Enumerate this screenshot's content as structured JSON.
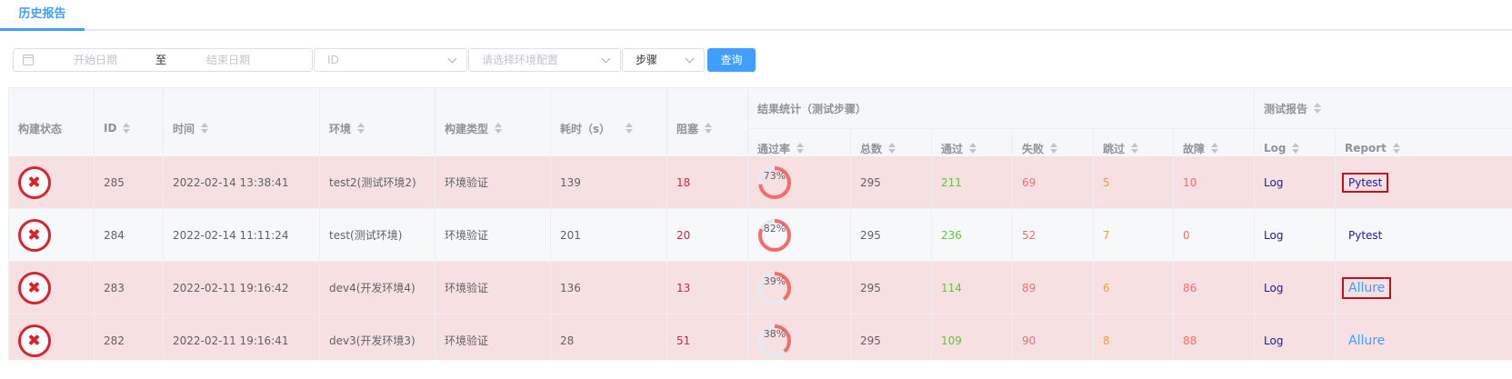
{
  "tab": {
    "label": "历史报告"
  },
  "filters": {
    "start_placeholder": "开始日期",
    "separator": "至",
    "end_placeholder": "结束日期",
    "id_placeholder": "ID",
    "env_placeholder": "请选择环境配置",
    "step_value": "步骤",
    "query_label": "查询"
  },
  "table": {
    "headers": {
      "status": "构建状态",
      "id": "ID",
      "time": "时间",
      "env": "环境",
      "build_type": "构建类型",
      "duration": "耗时（s）",
      "blocked": "阻塞",
      "result_group": "结果统计（测试步骤）",
      "pass_rate": "通过率",
      "total": "总数",
      "passed": "通过",
      "failed": "失败",
      "skipped": "跳过",
      "fault": "故障",
      "report_group": "测试报告",
      "log": "Log",
      "report": "Report"
    },
    "rows": [
      {
        "id": "285",
        "time": "2022-02-14 13:38:41",
        "env": "test2(测试环境2)",
        "build_type": "环境验证",
        "duration": "139",
        "blocked": "18",
        "pass_rate": 73,
        "pass_rate_label": "73%",
        "total": "295",
        "passed": "211",
        "failed": "69",
        "skipped": "5",
        "fault": "10",
        "log": "Log",
        "report": "Pytest",
        "report_kind": "pytest",
        "highlighted": true,
        "row_status": "failed"
      },
      {
        "id": "284",
        "time": "2022-02-14 11:11:24",
        "env": "test(测试环境)",
        "build_type": "环境验证",
        "duration": "201",
        "blocked": "20",
        "pass_rate": 82,
        "pass_rate_label": "82%",
        "total": "295",
        "passed": "236",
        "failed": "52",
        "skipped": "7",
        "fault": "0",
        "log": "Log",
        "report": "Pytest",
        "report_kind": "pytest",
        "highlighted": false,
        "row_status": "normal"
      },
      {
        "id": "283",
        "time": "2022-02-11 19:16:42",
        "env": "dev4(开发环境4)",
        "build_type": "环境验证",
        "duration": "136",
        "blocked": "13",
        "pass_rate": 39,
        "pass_rate_label": "39%",
        "total": "295",
        "passed": "114",
        "failed": "89",
        "skipped": "6",
        "fault": "86",
        "log": "Log",
        "report": "Allure",
        "report_kind": "allure",
        "highlighted": true,
        "row_status": "failed"
      },
      {
        "id": "282",
        "time": "2022-02-11 19:16:41",
        "env": "dev3(开发环境3)",
        "build_type": "环境验证",
        "duration": "28",
        "blocked": "51",
        "pass_rate": 38,
        "pass_rate_label": "38%",
        "total": "295",
        "passed": "109",
        "failed": "90",
        "skipped": "8",
        "fault": "88",
        "log": "Log",
        "report": "Allure",
        "report_kind": "allure",
        "highlighted": false,
        "row_status": "failed"
      }
    ]
  },
  "colors": {
    "accent": "#409eff",
    "failed_row": "#f7e0e1",
    "error_red": "#d9242e",
    "ring_track": "#e5e9f2",
    "ring_fill": "#f56c6c"
  },
  "icons": {
    "calendar": "calendar-icon",
    "status_failed": "error-circle-icon",
    "dropdown": "chevron-down-icon",
    "sort": "sort-caret-icon"
  }
}
